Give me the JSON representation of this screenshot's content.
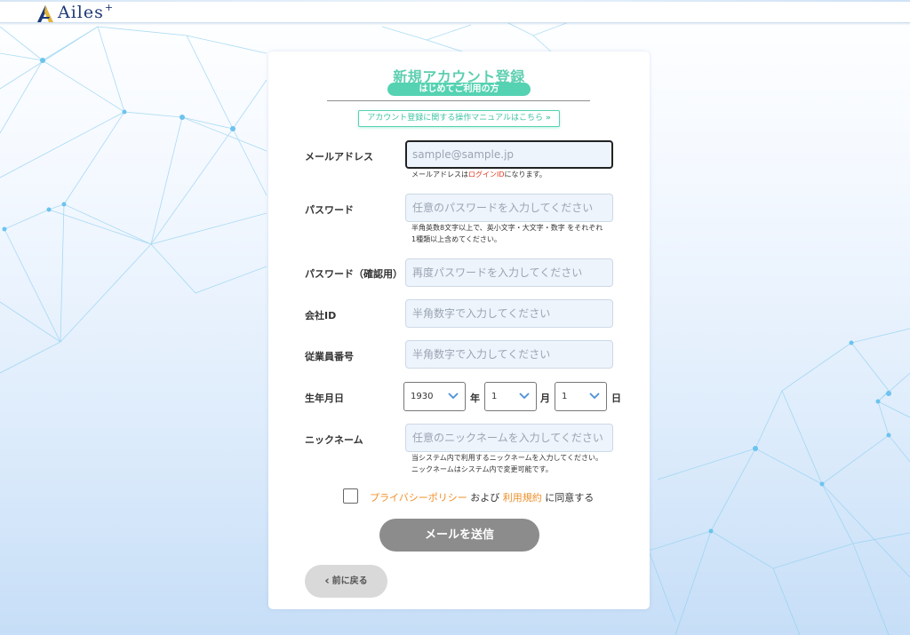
{
  "brand": {
    "name": "Ailes",
    "plus": "+"
  },
  "form": {
    "title": "新規アカウント登録",
    "subtitle": "はじめてご利用の方",
    "manual_link": "アカウント登録に関する操作マニュアルはこちら",
    "manual_chevron": "»",
    "email": {
      "label": "メールアドレス",
      "placeholder": "sample@sample.jp",
      "help_prefix": "メールアドレスは",
      "help_em": "ログインID",
      "help_suffix": "になります。"
    },
    "password": {
      "label": "パスワード",
      "placeholder": "任意のパスワードを入力してください",
      "help_line1": "半角英数8文字以上で、英小文字・大文字・数字 をそれぞれ",
      "help_line2": "1種類以上含めてください。"
    },
    "password_confirm": {
      "label": "パスワード（確認用）",
      "placeholder": "再度パスワードを入力してください"
    },
    "company_id": {
      "label": "会社ID",
      "placeholder": "半角数字で入力してください"
    },
    "employee_no": {
      "label": "従業員番号",
      "placeholder": "半角数字で入力してください"
    },
    "birthdate": {
      "label": "生年月日",
      "year": "1930",
      "year_unit": "年",
      "month": "1",
      "month_unit": "月",
      "day": "1",
      "day_unit": "日"
    },
    "nickname": {
      "label": "ニックネーム",
      "placeholder": "任意のニックネームを入力してください",
      "help_line1": "当システム内で利用するニックネームを入力してください。",
      "help_line2": "ニックネームはシステム内で変更可能です。"
    },
    "agreement": {
      "privacy": "プライバシーポリシー",
      "and": " および ",
      "terms": "利用規約",
      "suffix": " に同意する",
      "checked": false
    },
    "send_button": "メールを送信",
    "back_button": "前に戻る",
    "back_arrow": "‹"
  },
  "colors": {
    "accent": "#55d2b2",
    "link": "#f0902a",
    "error_red": "#e03a1e",
    "button_gray": "#8c8c8c"
  }
}
